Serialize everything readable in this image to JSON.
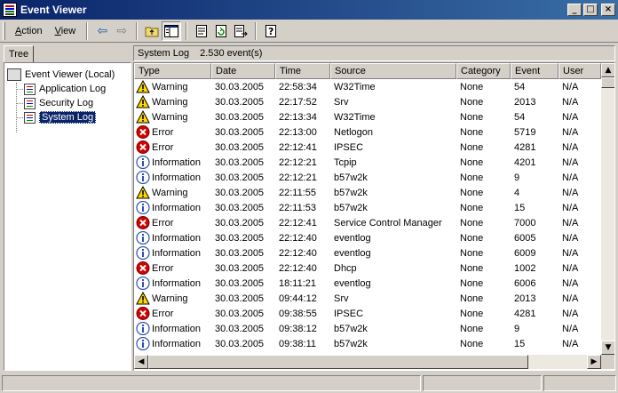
{
  "window": {
    "title": "Event Viewer"
  },
  "menu": {
    "action": {
      "accel": "A",
      "rest": "ction"
    },
    "view": {
      "accel": "V",
      "rest": "iew"
    }
  },
  "toolbar": {
    "buttons": [
      "back-icon",
      "forward-icon",
      "up-folder-icon",
      "show-tree-icon",
      "properties-icon",
      "refresh-icon",
      "export-icon",
      "help-icon"
    ]
  },
  "tree": {
    "tab_label": "Tree",
    "root": "Event Viewer (Local)",
    "items": [
      {
        "label": "Application Log",
        "selected": false
      },
      {
        "label": "Security Log",
        "selected": false
      },
      {
        "label": "System Log",
        "selected": true
      }
    ]
  },
  "list": {
    "log_name": "System Log",
    "event_count": "2.530 event(s)",
    "columns": [
      "Type",
      "Date",
      "Time",
      "Source",
      "Category",
      "Event",
      "User"
    ],
    "rows": [
      {
        "type": "Warning",
        "date": "30.03.2005",
        "time": "22:58:34",
        "source": "W32Time",
        "category": "None",
        "event": "54",
        "user": "N/A"
      },
      {
        "type": "Warning",
        "date": "30.03.2005",
        "time": "22:17:52",
        "source": "Srv",
        "category": "None",
        "event": "2013",
        "user": "N/A"
      },
      {
        "type": "Warning",
        "date": "30.03.2005",
        "time": "22:13:34",
        "source": "W32Time",
        "category": "None",
        "event": "54",
        "user": "N/A"
      },
      {
        "type": "Error",
        "date": "30.03.2005",
        "time": "22:13:00",
        "source": "Netlogon",
        "category": "None",
        "event": "5719",
        "user": "N/A"
      },
      {
        "type": "Error",
        "date": "30.03.2005",
        "time": "22:12:41",
        "source": "IPSEC",
        "category": "None",
        "event": "4281",
        "user": "N/A"
      },
      {
        "type": "Information",
        "date": "30.03.2005",
        "time": "22:12:21",
        "source": "Tcpip",
        "category": "None",
        "event": "4201",
        "user": "N/A"
      },
      {
        "type": "Information",
        "date": "30.03.2005",
        "time": "22:12:21",
        "source": "b57w2k",
        "category": "None",
        "event": "9",
        "user": "N/A"
      },
      {
        "type": "Warning",
        "date": "30.03.2005",
        "time": "22:11:55",
        "source": "b57w2k",
        "category": "None",
        "event": "4",
        "user": "N/A"
      },
      {
        "type": "Information",
        "date": "30.03.2005",
        "time": "22:11:53",
        "source": "b57w2k",
        "category": "None",
        "event": "15",
        "user": "N/A"
      },
      {
        "type": "Error",
        "date": "30.03.2005",
        "time": "22:12:41",
        "source": "Service Control Manager",
        "category": "None",
        "event": "7000",
        "user": "N/A"
      },
      {
        "type": "Information",
        "date": "30.03.2005",
        "time": "22:12:40",
        "source": "eventlog",
        "category": "None",
        "event": "6005",
        "user": "N/A"
      },
      {
        "type": "Information",
        "date": "30.03.2005",
        "time": "22:12:40",
        "source": "eventlog",
        "category": "None",
        "event": "6009",
        "user": "N/A"
      },
      {
        "type": "Error",
        "date": "30.03.2005",
        "time": "22:12:40",
        "source": "Dhcp",
        "category": "None",
        "event": "1002",
        "user": "N/A"
      },
      {
        "type": "Information",
        "date": "30.03.2005",
        "time": "18:11:21",
        "source": "eventlog",
        "category": "None",
        "event": "6006",
        "user": "N/A"
      },
      {
        "type": "Warning",
        "date": "30.03.2005",
        "time": "09:44:12",
        "source": "Srv",
        "category": "None",
        "event": "2013",
        "user": "N/A"
      },
      {
        "type": "Error",
        "date": "30.03.2005",
        "time": "09:38:55",
        "source": "IPSEC",
        "category": "None",
        "event": "4281",
        "user": "N/A"
      },
      {
        "type": "Information",
        "date": "30.03.2005",
        "time": "09:38:12",
        "source": "b57w2k",
        "category": "None",
        "event": "9",
        "user": "N/A"
      },
      {
        "type": "Information",
        "date": "30.03.2005",
        "time": "09:38:11",
        "source": "b57w2k",
        "category": "None",
        "event": "15",
        "user": "N/A"
      }
    ]
  },
  "colors": {
    "titlebar_start": "#0a246a",
    "titlebar_end": "#3a6ea5",
    "warning": "#ffd800",
    "error": "#d40000",
    "information": "#2a4fb0"
  }
}
